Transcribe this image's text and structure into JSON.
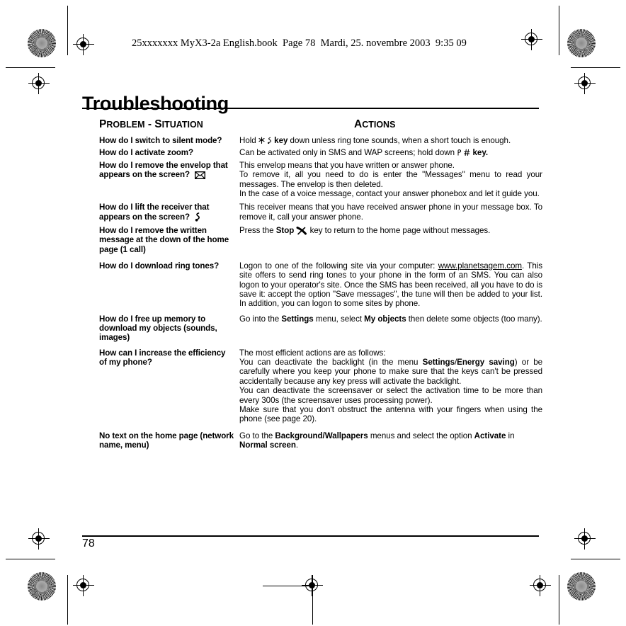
{
  "book_header": "25xxxxxxx MyX3-2a English.book  Page 78  Mardi, 25. novembre 2003  9:35 09",
  "title": "Troubleshooting",
  "columns": {
    "problem": {
      "first": "P",
      "rest": "ROBLEM",
      "sep": " - ",
      "first2": "S",
      "rest2": "ITUATION"
    },
    "actions": {
      "first": "A",
      "rest": "CTIONS"
    }
  },
  "page_number": "78",
  "faq": [
    {
      "question": "How do I switch to silent mode?",
      "question_icon": null,
      "answer_parts": [
        {
          "text": "Hold ",
          "bold": false
        },
        {
          "icon": "star-key-icon"
        },
        {
          "icon": "note-key-icon"
        },
        {
          "text": "key",
          "bold": true
        },
        {
          "text": " down unless ring tone sounds, when a short touch is enough.",
          "bold": false
        }
      ]
    },
    {
      "question": "How do I activate zoom?",
      "answer_parts": [
        {
          "text": "Can be activated only in SMS and WAP screens; hold down ",
          "bold": false
        },
        {
          "icon": "p-key-icon"
        },
        {
          "icon": "hash-key-icon"
        },
        {
          "text": "key.",
          "bold": true
        }
      ]
    },
    {
      "question": "How do I remove the envelop that appears on the screen?",
      "question_icon": "envelope-icon",
      "paragraphs": [
        "This envelop means that you have written or answer phone.",
        "To remove it, all you need to do is enter the \"Messages\" menu to read your messages. The envelop is then deleted.",
        "In the case of a voice message, contact your answer phonebox and let it guide you."
      ]
    },
    {
      "question": "How do I lift the receiver that appears on the screen?",
      "question_icon": "handset-icon",
      "paragraphs": [
        "This receiver means that you have received answer phone in your message box. To remove it, call your answer phone."
      ]
    },
    {
      "question": "How do I remove the written message at the down of the home page (1 call)",
      "answer_parts": [
        {
          "text": "Press the ",
          "bold": false
        },
        {
          "text": "Stop",
          "bold": true
        },
        {
          "icon": "hangup-key-icon"
        },
        {
          "text": " key to return to the home page without messages.",
          "bold": false
        }
      ]
    },
    {
      "question": "How do I download ring tones?",
      "answer_rich": [
        {
          "text": "Logon to one of the following site via your computer: "
        },
        {
          "text": "www.planetsagem.com",
          "link": true
        },
        {
          "text": ". This site offers to send ring tones to your phone in the form of an SMS. You can also logon to your operator's site. Once the SMS has been received, all you have to do is save it: accept the option \"Save messages\", the tune will then be added to your list. In addition, you can logon to some sites by phone."
        }
      ]
    },
    {
      "question": "How do I free up memory to download my objects (sounds, images)",
      "answer_parts": [
        {
          "text": "Go into the ",
          "bold": false
        },
        {
          "text": "Settings",
          "bold": true
        },
        {
          "text": " menu, select ",
          "bold": false
        },
        {
          "text": "My objects",
          "bold": true
        },
        {
          "text": " then delete some objects (too many).",
          "bold": false
        }
      ]
    },
    {
      "question": "How can I increase the efficiency of my phone?",
      "multi": [
        [
          {
            "text": "The most efficient actions are as follows:",
            "bold": false
          }
        ],
        [
          {
            "text": "You can deactivate the backlight (in the menu ",
            "bold": false
          },
          {
            "text": "Settings",
            "bold": true
          },
          {
            "text": "/",
            "bold": false
          },
          {
            "text": "Energy saving",
            "bold": true
          },
          {
            "text": ") or be carefully where you keep your phone to make sure that the keys can't be pressed accidentally because any key press will activate the backlight.",
            "bold": false
          }
        ],
        [
          {
            "text": "You can deactivate the screensaver or select the activation time to be more than every 300s (the screensaver uses processing power).",
            "bold": false
          }
        ],
        [
          {
            "text": "Make sure that you don't obstruct the antenna with your fingers when using the phone (see page 20).",
            "bold": false
          }
        ]
      ]
    },
    {
      "question": "No text on the home page (network name, menu)",
      "answer_parts": [
        {
          "text": "Go to the ",
          "bold": false
        },
        {
          "text": "Background/Wallpapers",
          "bold": true
        },
        {
          "text": " menus and select the option ",
          "bold": false
        },
        {
          "text": "Activate",
          "bold": true
        },
        {
          "text": " in ",
          "bold": false
        },
        {
          "text": "Normal screen",
          "bold": true
        },
        {
          "text": ".",
          "bold": false
        }
      ]
    }
  ]
}
